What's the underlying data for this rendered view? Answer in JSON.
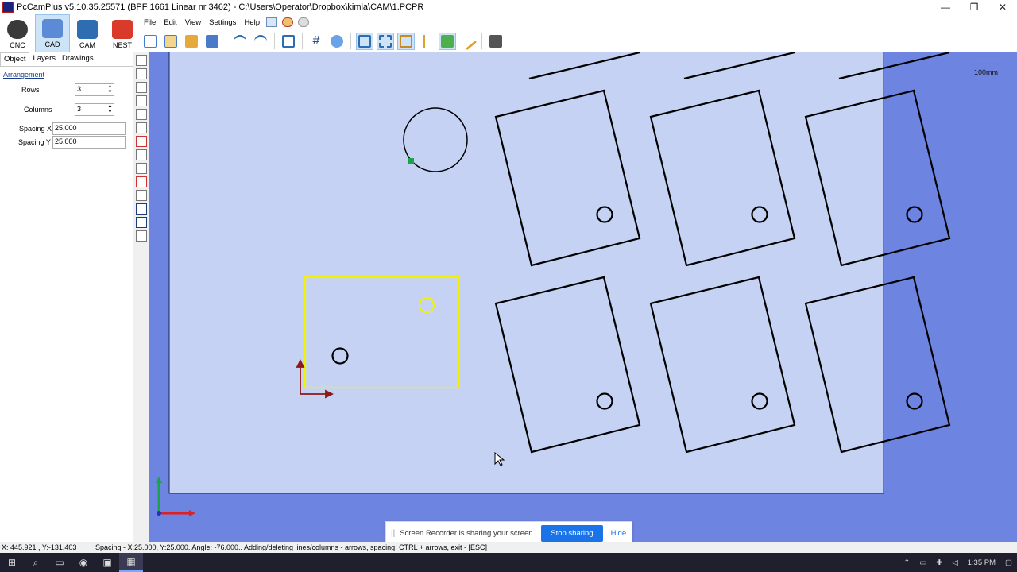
{
  "window": {
    "title": "PcCamPlus v5.10.35.25571 (BPF 1661 Linear nr 3462) - C:\\Users\\Operator\\Dropbox\\kimla\\CAM\\1.PCPR",
    "minimize": "—",
    "restore": "❐",
    "close": "✕"
  },
  "modes": [
    {
      "label": "CNC",
      "color": "#3a3a3a"
    },
    {
      "label": "CAD",
      "color": "#5b8bd6"
    },
    {
      "label": "CAM",
      "color": "#2f6db3"
    },
    {
      "label": "NEST",
      "color": "#d93a2a"
    }
  ],
  "menu": [
    "File",
    "Edit",
    "View",
    "Settings",
    "Help"
  ],
  "left_tabs": [
    "Object",
    "Layers",
    "Drawings"
  ],
  "arrangement": {
    "title": "Arrangement",
    "rows_label": "Rows",
    "rows_value": "3",
    "columns_label": "Columns",
    "columns_value": "3",
    "spacing_x_label": "Spacing X",
    "spacing_x_value": "25.000",
    "spacing_y_label": "Spacing Y",
    "spacing_y_value": "25.000"
  },
  "canvas": {
    "scale_label": "100mm",
    "background": "#6d84e0",
    "sheet_color": "#c5d2f3"
  },
  "share_bar": {
    "grip": "||",
    "message": "Screen Recorder is sharing your screen.",
    "stop_label": "Stop sharing",
    "hide_label": "Hide"
  },
  "status": {
    "coords": "X: 445.921 , Y:-131.403",
    "info": "Spacing - X:25.000, Y:25.000. Angle: -76.000.. Adding/deleting lines/columns - arrows, spacing: CTRL + arrows, exit - [ESC]"
  },
  "taskbar": {
    "time": "1:35 PM"
  }
}
